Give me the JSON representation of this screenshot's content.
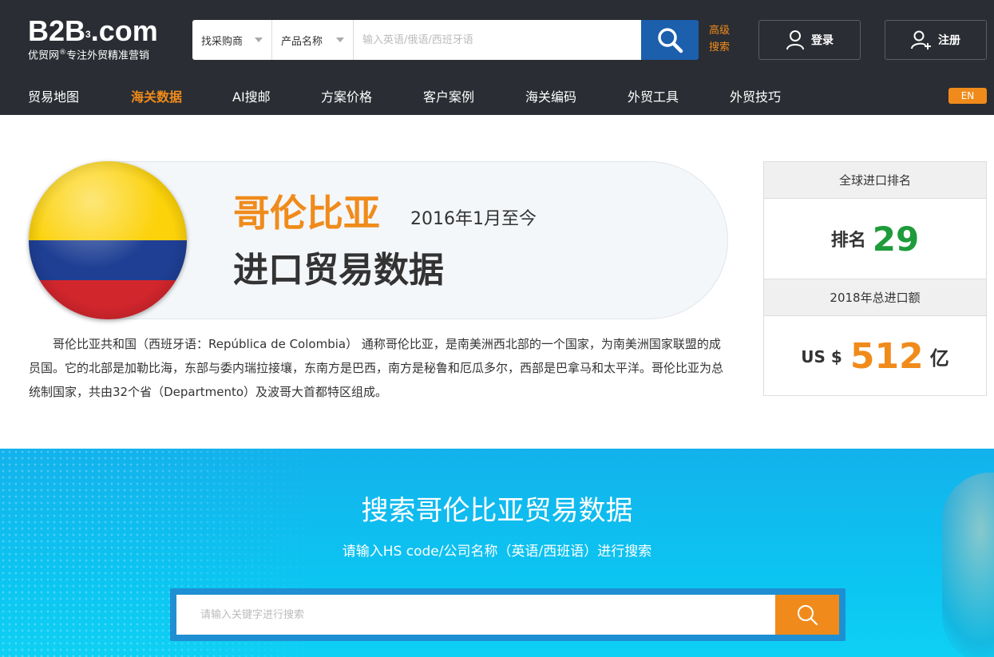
{
  "header": {
    "logo_main": "B2B",
    "logo_sup": "3",
    "logo_domain": ".com",
    "logo_sub_brand": "优贸网",
    "logo_sub_mark": "®",
    "logo_tagline": "专注外贸精准营销",
    "select_buyer": "找采购商",
    "select_product": "产品名称",
    "search_placeholder": "输入英语/俄语/西班牙语",
    "advanced_search": "高级搜索",
    "login": "登录",
    "register": "注册"
  },
  "nav": {
    "items": [
      "贸易地图",
      "海关数据",
      "AI搜邮",
      "方案价格",
      "客户案例",
      "海关编码",
      "外贸工具",
      "外贸技巧"
    ],
    "active": "海关数据",
    "lang": "EN"
  },
  "country": {
    "name": "哥伦比亚",
    "period": "2016年1月至今",
    "title": "进口贸易数据",
    "intro": "哥伦比亚共和国（西班牙语：República de Colombia） 通称哥伦比亚，是南美洲西北部的一个国家，为南美洲国家联盟的成员国。它的北部是加勒比海，东部与委内瑞拉接壤，东南方是巴西，南方是秘鲁和厄瓜多尔，西部是巴拿马和太平洋。哥伦比亚为总统制国家，共由32个省（Departmento）及波哥大首都特区组成。",
    "flag_colors": [
      "#fcd20a",
      "#1f3f94",
      "#d2262d"
    ]
  },
  "stats": {
    "rank_header": "全球进口排名",
    "rank_label": "排名",
    "rank_value": "29",
    "import_header": "2018年总进口额",
    "import_prefix": "US $",
    "import_value": "512",
    "import_unit": "亿"
  },
  "hero": {
    "title": "搜索哥伦比亚贸易数据",
    "subtitle": "请输入HS code/公司名称（英语/西班语）进行搜索",
    "placeholder": "请输入关键字进行搜索"
  },
  "colors": {
    "accent": "#f08b1b",
    "header_bg": "#2a2d33",
    "search_btn": "#1b5fad",
    "rank_green": "#1e9b3a",
    "hero_blue": "#13b2ec"
  }
}
